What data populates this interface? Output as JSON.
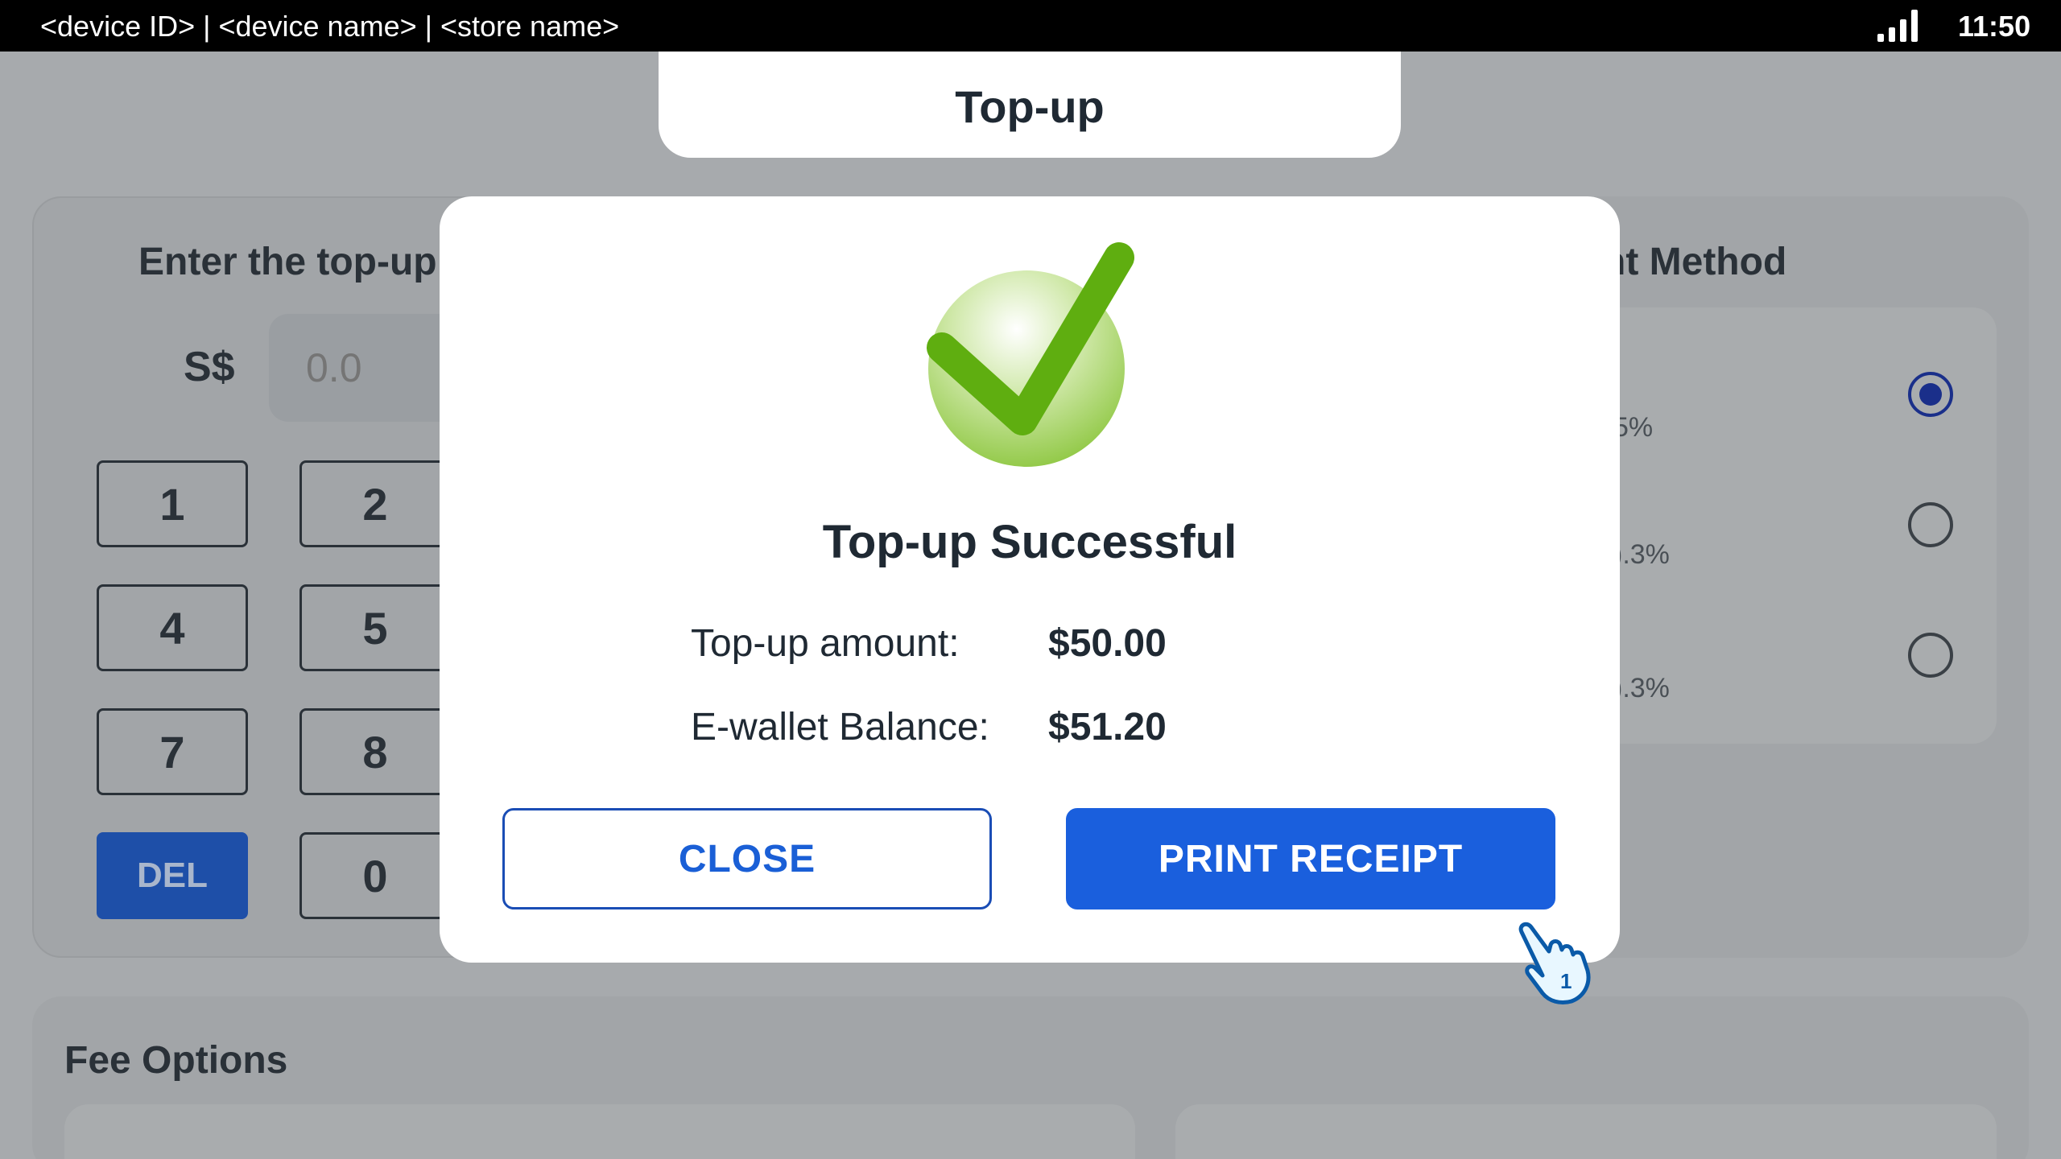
{
  "status_bar": {
    "device_info": "<device ID> | <device name> | <store name>",
    "time": "11:50",
    "signal_icon": "signal-bars-icon"
  },
  "header": {
    "title": "Top-up"
  },
  "amount_panel": {
    "title": "Enter the top-up",
    "currency": "S$",
    "input_placeholder": "0.0",
    "keys": [
      "1",
      "2",
      "4",
      "5",
      "7",
      "8",
      "DEL",
      "0"
    ]
  },
  "method_panel": {
    "title": "nt Method",
    "options": [
      {
        "fee": "5%",
        "selected": true
      },
      {
        "fee": ").3%",
        "selected": false
      },
      {
        "fee": ").3%",
        "selected": false
      }
    ]
  },
  "fee_panel": {
    "title": "Fee Options"
  },
  "modal": {
    "icon": "success-check-icon",
    "title": "Top-up Successful",
    "amount_label": "Top-up amount:",
    "amount_value": "$50.00",
    "balance_label": "E-wallet Balance:",
    "balance_value": "$51.20",
    "close_label": "CLOSE",
    "print_label": "PRINT RECEIPT"
  },
  "colors": {
    "primary": "#1a5fdd",
    "success": "#5fae10",
    "overlay": "#a7aaad"
  }
}
